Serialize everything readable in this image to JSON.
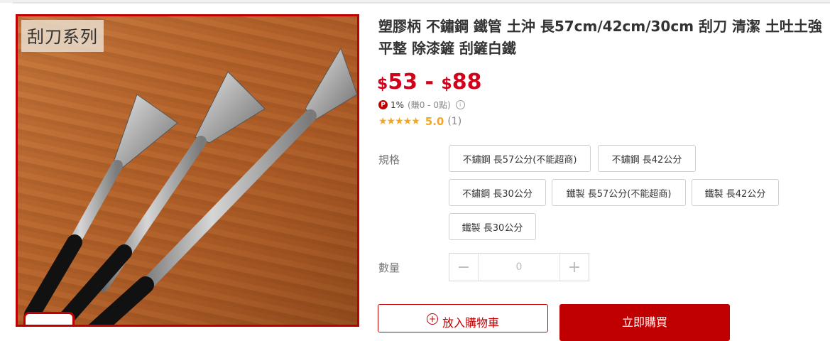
{
  "gallery": {
    "label": "刮刀系列"
  },
  "product": {
    "title": "塑膠柄 不鏽鋼 鐵管 土沖 長57cm/42cm/30cm 刮刀 清潔 土吐土強 平整 除漆鏟 刮鏟白鐵",
    "price_currency": "$",
    "price_min": "53",
    "price_sep": " - ",
    "price_max": "88",
    "points_badge": "P",
    "points_rate": "1%",
    "points_earn": "(賺0 - 0點)",
    "rating_stars": "★★★★★",
    "rating_score": "5.0",
    "rating_count": "(1)"
  },
  "spec": {
    "label": "規格",
    "options": [
      "不鏽鋼 長57公分(不能超商)",
      "不鏽鋼 長42公分",
      "不鏽鋼 長30公分",
      "鐵製 長57公分(不能超商)",
      "鐵製 長42公分",
      "鐵製 長30公分"
    ]
  },
  "quantity": {
    "label": "數量",
    "minus": "−",
    "value": "0",
    "plus": "+"
  },
  "actions": {
    "cart_label": "放入購物車",
    "buy_label": "立即購買"
  },
  "colors": {
    "accent": "#c00000",
    "price": "#d0021b",
    "star": "#f5a623"
  }
}
